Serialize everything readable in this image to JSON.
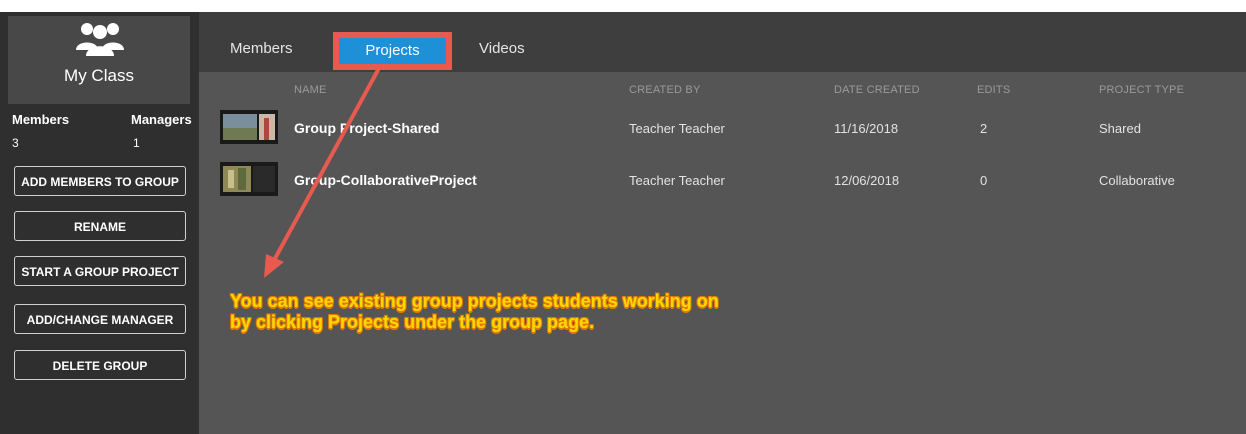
{
  "sidebar": {
    "class_name": "My Class",
    "members_label": "Members",
    "members_count": "3",
    "managers_label": "Managers",
    "managers_count": "1",
    "buttons": [
      "ADD MEMBERS TO GROUP",
      "RENAME",
      "START A GROUP PROJECT",
      "ADD/CHANGE MANAGER",
      "DELETE GROUP"
    ]
  },
  "tabs": [
    "Members",
    "Projects",
    "Videos"
  ],
  "active_tab": "Projects",
  "table": {
    "columns": [
      "NAME",
      "CREATED BY",
      "DATE CREATED",
      "EDITS",
      "PROJECT TYPE"
    ],
    "rows": [
      {
        "name": "Group Project-Shared",
        "created_by": "Teacher Teacher",
        "date": "11/16/2018",
        "edits": "2",
        "type": "Shared"
      },
      {
        "name": "Group-CollaborativeProject",
        "created_by": "Teacher Teacher",
        "date": "12/06/2018",
        "edits": "0",
        "type": "Collaborative"
      }
    ]
  },
  "annotation": "You can see existing group projects students working on by clicking Projects under the group page.",
  "colors": {
    "accent_tab": "#1e90d8",
    "highlight": "#e85a4f",
    "annotation_text": "#ffd700"
  },
  "icons": [
    "group-icon"
  ]
}
